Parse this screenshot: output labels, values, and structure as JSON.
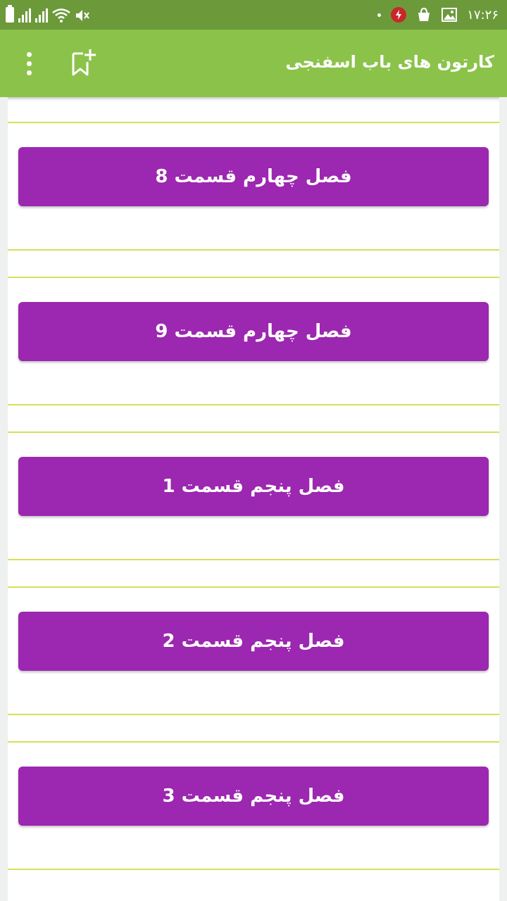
{
  "status_bar": {
    "time": "۱۷:۲۶",
    "icons": [
      "battery-icon",
      "signal-icon",
      "signal-icon",
      "wifi-icon",
      "mute-icon",
      "dot-icon",
      "charging-icon",
      "bag-icon",
      "gallery-icon"
    ]
  },
  "app_bar": {
    "title": "کارتون های باب اسفنجی",
    "actions": [
      "bookmark-add-icon",
      "overflow-menu-icon"
    ]
  },
  "episodes": [
    {
      "label": "فصل چهارم قسمت 8"
    },
    {
      "label": "فصل چهارم قسمت 9"
    },
    {
      "label": "فصل پنجم قسمت 1"
    },
    {
      "label": "فصل پنجم قسمت 2"
    },
    {
      "label": "فصل پنجم قسمت 3"
    }
  ],
  "colors": {
    "status_bar": "#6c9a3b",
    "app_bar": "#8bc34a",
    "button": "#9c27b0",
    "divider": "#d6df5a"
  }
}
